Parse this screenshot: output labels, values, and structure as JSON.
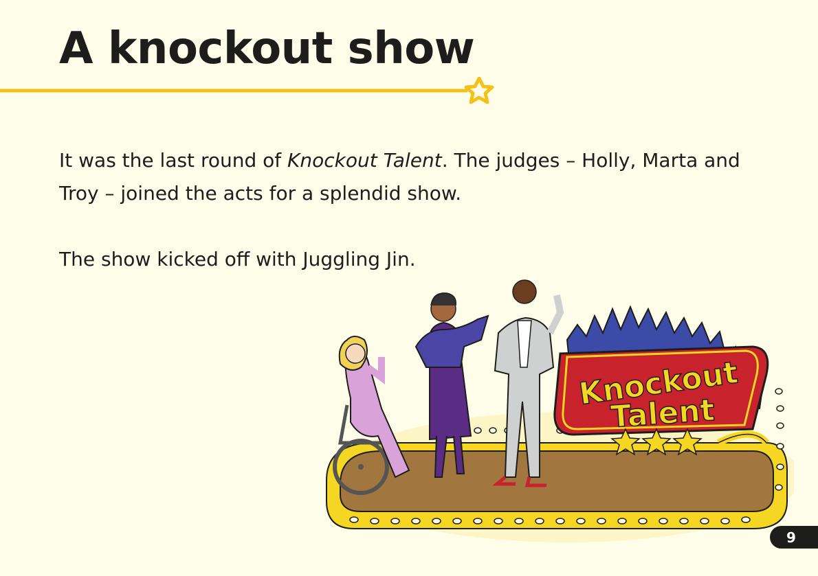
{
  "page": {
    "title": "A knockout show",
    "paragraph1": {
      "before": "It was the last round of ",
      "emphasis": "Knockout Talent",
      "after": ". The judges – Holly, Marta and Troy – joined the acts for a splendid show."
    },
    "paragraph2": "The show kicked off with Juggling Jin.",
    "page_number": "9"
  },
  "illustration": {
    "sign_line1": "Knockout",
    "sign_line2": "Talent"
  },
  "colors": {
    "background": "#fefdea",
    "accent_yellow": "#f2c21b",
    "sign_red": "#c8232c",
    "text": "#1d1d1b"
  }
}
